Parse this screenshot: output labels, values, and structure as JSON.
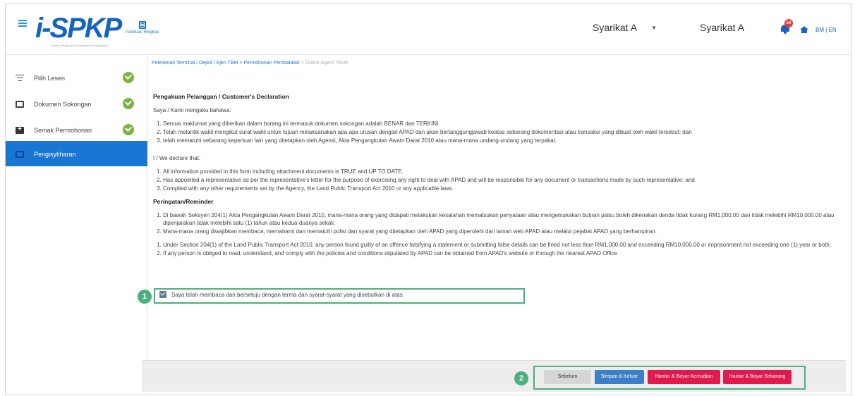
{
  "header": {
    "logo_text": "i-SPKP",
    "logo_tagline": "Sistem Pengurusan Kenderaan Perdagangan",
    "guide_label": "Panduan Ringkas",
    "company_select": "Syarikat A",
    "company_name": "Syarikat A",
    "notification_count": "54",
    "lang_bm": "BM",
    "lang_sep": "|",
    "lang_en": "EN",
    "icons": [
      "menu-icon",
      "book-icon",
      "bell-icon",
      "home-icon"
    ]
  },
  "sidebar": {
    "items": [
      {
        "label": "Pilih Lesen",
        "icon": "filter-icon",
        "completed": true
      },
      {
        "label": "Dokumen Sokongan",
        "icon": "document-icon",
        "completed": true
      },
      {
        "label": "Semak Permohonan",
        "icon": "review-icon",
        "completed": true
      },
      {
        "label": "Pengisytiharan",
        "icon": "form-icon",
        "completed": false,
        "active": true
      }
    ]
  },
  "breadcrumb": {
    "item1": "Pelesenan Terminal / Depot / Ejen Tiket",
    "sep1": " > ",
    "item2": "Permohonan Pembatalan",
    "sep2": " > ",
    "item3": "Online Agent Ticket"
  },
  "declaration": {
    "title": "Pengakuan Pelanggan / Customer's Declaration",
    "intro_bm": "Saya / Kami mengaku bahawa:",
    "items_bm": [
      "Semua maklumat yang diberikan dalam borang ini termasuk dokumen sokongan adalah BENAR dan TERKINI.",
      "Telah melantik wakil mengikut surat wakil untuk tujuan melaksanakan apa-apa urusan dengan APAD dan akan bertanggungjawab keatas sebarang dokumentasi atau transaksi yang dibuat oleh wakil tersebut; dan",
      "telah mematuhi sebarang keperluan lain yang ditetapkan oleh Agensi, Akta Pengangkutan Awam Darat 2010 atau mana-mana undang-undang yang terpakai."
    ],
    "intro_en": "I / We declare that:",
    "items_en": [
      "All information provided in this form including attachment documents is TRUE and UP TO DATE.",
      "Has appointed a representative as per the representative's letter for the purpose of exercising any right to deal with APAD and will be responsible for any document or transactions made by such representative; and",
      "Complied with any other requirements set by the Agency, the Land Public Transport Act 2010 or any applicable laws."
    ]
  },
  "reminder": {
    "title": "Peringatan/Reminder",
    "items_bm": [
      "Di bawah Seksyen 204(1) Akta Pengangkutan Awam Darat 2010, mana-mana orang yang didapati melakukan kesalahan memalsukan penyataan atau mengemukakan butiran palsu boleh dikenakan denda tidak kurang RM1,000.00 dan tidak melebihi RM10,000.00 atau dipenjarakan tidak melebihi satu (1) tahun atau kedua-duanya sekali.",
      "Mana-mana orang diwajibkan membaca, memahami dan mematuhi polisi dan syarat yang ditetapkan oleh APAD yang diperolehi dari laman web APAD atau melalui pejabat APAD yang berhampiran."
    ],
    "items_en": [
      "Under Section 204(1) of the Land Public Transport Act 2010, any person found guilty of an offence falsifying a statement or submitting false details can be fined not less than RM1,000.00 and exceeding RM10,000.00 or imprisonment not exceeding one (1) year or both.",
      "If any person is obliged to read, understand, and comply with the policies and conditions stipulated by APAD can be obtained from APAD's website or through the nearest APAD Office"
    ]
  },
  "agreement": {
    "label": "Saya telah membaca dan bersetuju dengan terma dan syarat-syarat yang disebutkan di atas.",
    "checked": true
  },
  "markers": {
    "one": "1",
    "two": "2"
  },
  "footer": {
    "prev_label": "Sebelum",
    "save_label": "Simpan & Keluar",
    "submit_later_label": "Hantar & Bayar Kemudian",
    "submit_now_label": "Hantar & Bayar Sekarang"
  },
  "colors": {
    "primary": "#1976d2",
    "success": "#7cb342",
    "danger": "#e01a4f",
    "highlight": "#4caf7d"
  }
}
